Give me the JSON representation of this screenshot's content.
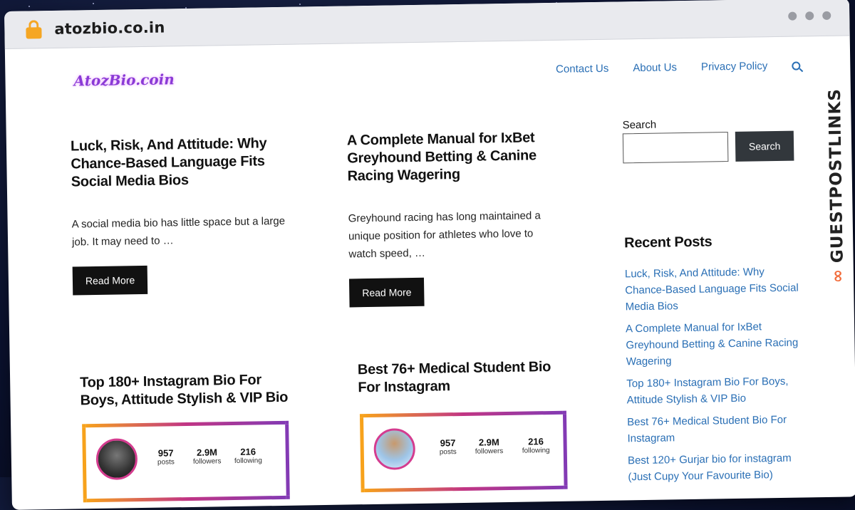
{
  "browser": {
    "url": "atozbio.co.in"
  },
  "site": {
    "logo": "AtozBio.coin",
    "nav": [
      "Contact Us",
      "About Us",
      "Privacy Policy"
    ]
  },
  "posts": [
    {
      "title": "Luck, Risk, And Attitude: Why Chance-Based Language Fits Social Media Bios",
      "excerpt": "A social media bio has little space but a large job. It may need to …",
      "cta": "Read More"
    },
    {
      "title": "A Complete Manual for IxBet Greyhound Betting & Canine Racing Wagering",
      "excerpt": "Greyhound racing has long maintained a unique position for athletes who love to watch speed, …",
      "cta": "Read More"
    },
    {
      "title": "Top 180+ Instagram Bio For Boys, Attitude Stylish & VIP Bio",
      "card": {
        "posts": "957",
        "posts_label": "posts",
        "followers": "2.9M",
        "followers_label": "followers",
        "following": "216",
        "following_label": "following"
      }
    },
    {
      "title": "Best 76+ Medical Student Bio For Instagram",
      "card": {
        "posts": "957",
        "posts_label": "posts",
        "followers": "2.9M",
        "followers_label": "followers",
        "following": "216",
        "following_label": "following"
      }
    }
  ],
  "sidebar": {
    "search_label": "Search",
    "search_button": "Search",
    "recent_title": "Recent Posts",
    "recent": [
      "Luck, Risk, And Attitude: Why Chance-Based Language Fits Social Media Bios",
      "A Complete Manual for IxBet Greyhound Betting & Canine Racing Wagering",
      "Top 180+ Instagram Bio For Boys, Attitude Stylish & VIP Bio",
      "Best 76+ Medical Student Bio For Instagram",
      "Best 120+ Gurjar bio for instagram (Just Cupy Your Favourite Bio)"
    ]
  },
  "watermark": "GUESTPOSTLINKS",
  "colors": {
    "link": "#2a6fb5",
    "button": "#111111",
    "accent": "#f26b3a"
  }
}
